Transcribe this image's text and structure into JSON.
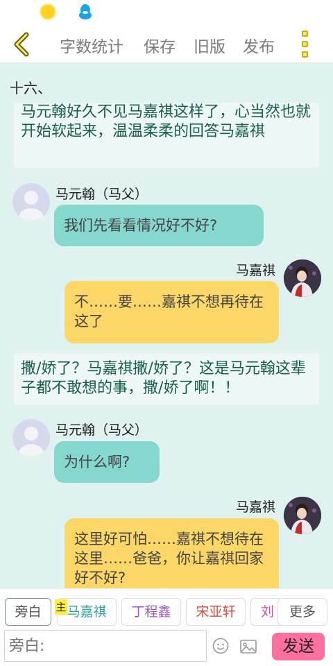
{
  "toolbar": {
    "word_count": "字数统计",
    "save": "保存",
    "old_version": "旧版",
    "publish": "发布"
  },
  "content": {
    "section": "十六、",
    "narration_1": "马元翰好久不见马嘉祺这样了，心当然也就开始软起来，温温柔柔的回答马嘉祺",
    "msg_1": {
      "name": "马元翰（马父）",
      "text": "我们先看看情况好不好?"
    },
    "msg_2": {
      "name": "马嘉祺",
      "text": "不……要……嘉祺不想再待在这了"
    },
    "narration_2": "撒/娇了？马嘉祺撒/娇了？这是马元翰这辈子都不敢想的事，撒/娇了啊！！",
    "msg_3": {
      "name": "马元翰（马父）",
      "text": "为什么啊?"
    },
    "msg_4": {
      "name": "马嘉祺",
      "text": "这里好可怕……嘉祺不想待在这里……爸爸，你让嘉祺回家好不好?"
    }
  },
  "characters": {
    "narrator": "旁白",
    "main_badge": "主",
    "c1": "马嘉祺",
    "c2": "丁程鑫",
    "c3": "宋亚轩",
    "c4": "刘",
    "more": "更多"
  },
  "input": {
    "placeholder": "旁白:",
    "send": "发送"
  },
  "colors": {
    "background": "#dff2ef",
    "teal_bubble": "#86d8cf",
    "yellow_bubble": "#fbd767",
    "send_button": "#ff6f9f",
    "narration_text": "#165e4e"
  },
  "icons": [
    "sun-icon",
    "qq-penguin-icon",
    "back-chevron-icon",
    "more-menu-icon",
    "emoji-icon",
    "image-icon"
  ]
}
